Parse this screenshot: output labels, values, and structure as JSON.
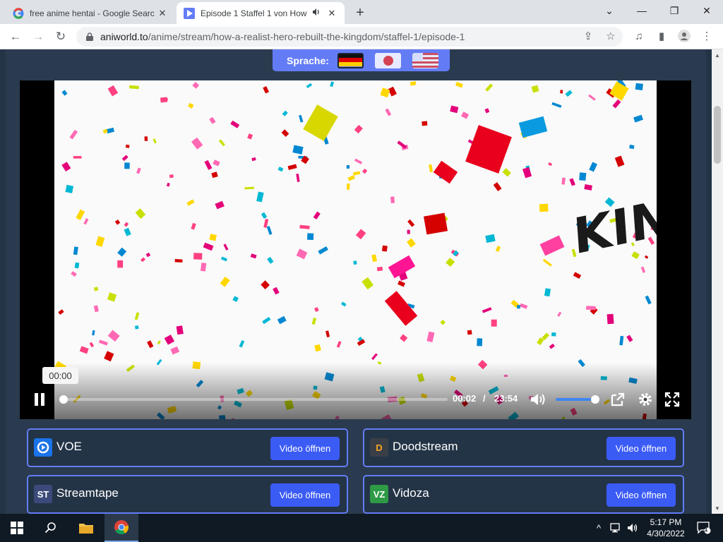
{
  "browser": {
    "tabs": [
      {
        "title": "free anime hentai - Google Searc",
        "active": false
      },
      {
        "title": "Episode 1 Staffel 1 von How",
        "active": true
      }
    ],
    "url_host": "aniworld.to",
    "url_path": "/anime/stream/how-a-realist-hero-rebuilt-the-kingdom/staffel-1/episode-1"
  },
  "page": {
    "language_label": "Sprache:",
    "video_overlay_text": "KIN",
    "player": {
      "tooltip_time": "00:00",
      "current_time": "00:02",
      "separator": "/",
      "duration": "23:54",
      "progress": 0.0014,
      "volume": 1.0
    },
    "hosters": [
      {
        "name": "VOE",
        "button": "Video öffnen",
        "logo_text": "",
        "color": "#1a73e8"
      },
      {
        "name": "Doodstream",
        "button": "Video öffnen",
        "logo_text": "D",
        "color": "#f6a623"
      },
      {
        "name": "Streamtape",
        "button": "Video öffnen",
        "logo_text": "ST",
        "color": "#3b4a7a"
      },
      {
        "name": "Vidoza",
        "button": "Video öffnen",
        "logo_text": "VZ",
        "color": "#2e9a46"
      }
    ]
  },
  "taskbar": {
    "time": "5:17 PM",
    "date": "4/30/2022",
    "notification_count": "1"
  },
  "colors": {
    "accent": "#637cf6",
    "button": "#3b5bf5",
    "page_bg": "#243447"
  }
}
